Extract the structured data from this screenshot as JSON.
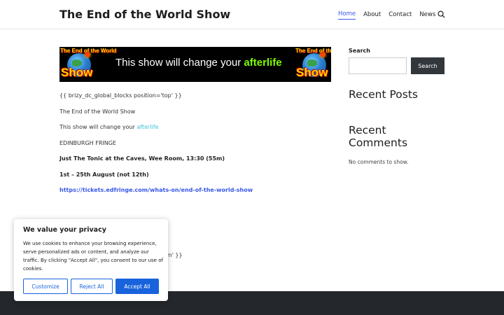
{
  "header": {
    "site_title": "The End of the World Show",
    "nav": [
      "Home",
      "About",
      "Contact",
      "News"
    ]
  },
  "banner": {
    "logo_top": "The End of the World",
    "logo_bottom": "Show",
    "tagline_prefix": "This show will change your ",
    "tagline_highlight": "afterlife"
  },
  "content": {
    "shortcode_top": "{{ brizy_dc_global_blocks position='top' }}",
    "show_title": "The End of the World Show",
    "tagline_prefix": "This show will change your ",
    "tagline_link": "afterlife",
    "festival": "EDINBURGH FRINGE",
    "venue": "Just The Tonic at the Caves, Wee Room, 13:30 (55m)",
    "dates": "1st – 25th August (not 12th)",
    "ticket_link": "https://tickets.edfringe.com/whats-on/end-of-the-world-show",
    "shortcode_bottom_visible": "om' }}"
  },
  "sidebar": {
    "search_label": "Search",
    "search_button": "Search",
    "recent_posts_title": "Recent Posts",
    "recent_comments_title": "Recent Comments",
    "no_comments": "No comments to show."
  },
  "cookie": {
    "title": "We value your privacy",
    "body": "We use cookies to enhance your browsing experience, serve personalized ads or content, and analyze our traffic. By clicking \"Accept All\", you consent to our use of cookies.",
    "customize": "Customize",
    "reject": "Reject All",
    "accept": "Accept All"
  },
  "colors": {
    "accent": "#3858e9",
    "cookie_blue": "#1863dc",
    "footer": "#24272b",
    "link_cyan": "#3ec4d6"
  }
}
